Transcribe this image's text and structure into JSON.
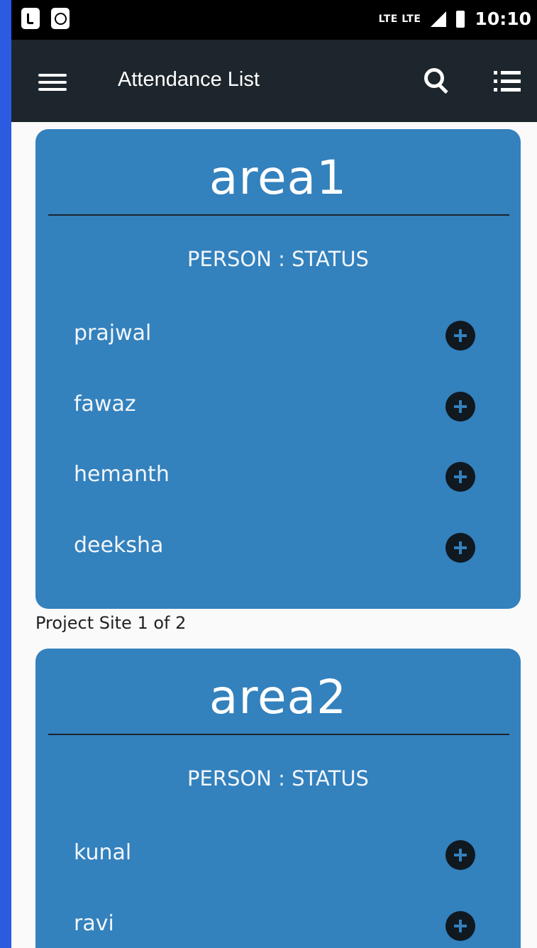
{
  "status_bar": {
    "network_label": "LTE LTE",
    "time": "10:10"
  },
  "app_bar": {
    "title": "Attendance List"
  },
  "cards": [
    {
      "title": "area1",
      "header": "PERSON  :  STATUS",
      "people": [
        "prajwal",
        "fawaz",
        "hemanth",
        "deeksha"
      ]
    },
    {
      "title": "area2",
      "header": "PERSON  :  STATUS",
      "people": [
        "kunal",
        "ravi"
      ]
    }
  ],
  "page_indicator": "Project Site 1 of 2",
  "colors": {
    "card_background": "#3381bd",
    "app_bar": "#1d262c",
    "frame": "#2a5be0"
  }
}
